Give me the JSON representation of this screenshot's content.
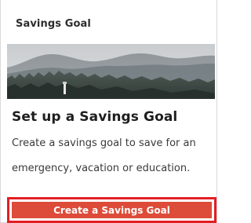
{
  "card": {
    "header_title": "Savings Goal",
    "hero_image": "misty-forest-mountains-lighthouse",
    "title": "Set up a Savings Goal",
    "description_lines": [
      "Create a savings goal to save for an",
      "emergency, vacation or education."
    ],
    "cta_label": "Create a Savings Goal"
  },
  "colors": {
    "cta_background": "#dd4b39",
    "cta_focus_outline": "#e31e24",
    "text_dark": "#1e1e1e",
    "border": "#d9d9d9"
  }
}
